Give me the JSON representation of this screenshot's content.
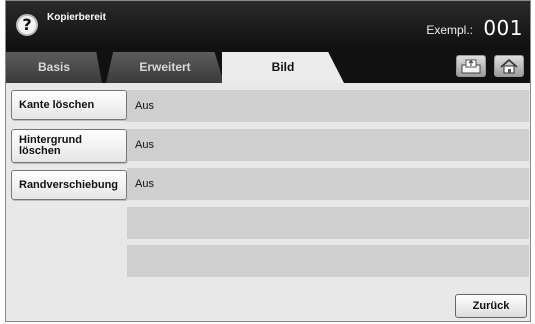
{
  "header": {
    "help_icon": "question-icon",
    "help_glyph": "?",
    "title": "Kopierbereit",
    "copies_label": "Exempl.:",
    "copies_value": "001"
  },
  "tabs": [
    {
      "label": "Basis",
      "active": false
    },
    {
      "label": "Erweitert",
      "active": false
    },
    {
      "label": "Bild",
      "active": true
    }
  ],
  "toolbar": {
    "tray_icon": "paper-tray-icon",
    "home_icon": "home-icon"
  },
  "settings": [
    {
      "label": "Kante löschen",
      "value": "Aus"
    },
    {
      "label_line1": "Hintergrund",
      "label_line2": "löschen",
      "value": "Aus"
    },
    {
      "label": "Randverschiebung",
      "value": "Aus"
    }
  ],
  "footer": {
    "back_label": "Zurück"
  }
}
